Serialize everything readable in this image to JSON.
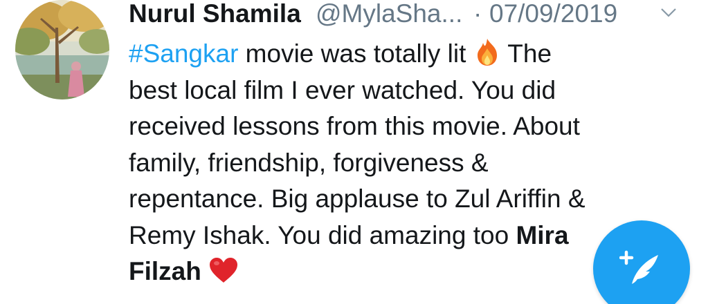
{
  "tweet": {
    "display_name": "Nurul Shamila",
    "handle": "@MylaSha...",
    "separator": "·",
    "date": "07/09/2019",
    "text_lines": [
      {
        "a": "#Sangkar",
        "b": " movie was totally lit ",
        "c": " The"
      },
      {
        "a": "best local film I ever watched. You did"
      },
      {
        "a": "received lessons from this movie. About"
      },
      {
        "a": "family, friendship, forgiveness &"
      },
      {
        "a": "repentance. Big applause to Zul Ariffin &"
      },
      {
        "a": "Remy Ishak. You did amazing too ",
        "b": "Mira"
      },
      {
        "a": "Filzah"
      }
    ]
  },
  "icons": {
    "caret": "chevron-down-icon",
    "fire": "fire-emoji",
    "heart": "red-heart-emoji",
    "compose": "compose-tweet-icon"
  },
  "colors": {
    "accent": "#1da1f2",
    "text": "#14171a",
    "muted": "#657786"
  }
}
